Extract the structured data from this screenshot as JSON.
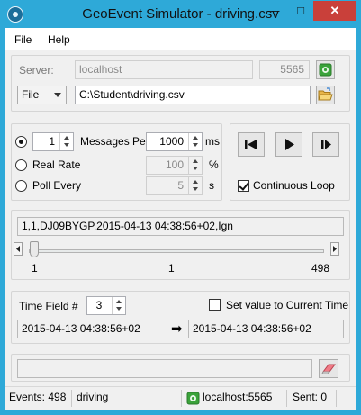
{
  "window": {
    "title": "GeoEvent Simulator - driving.csv",
    "minimize": "—",
    "maximize": "□",
    "close": "✕"
  },
  "menu": {
    "file": "File",
    "help": "Help"
  },
  "connection": {
    "server_label": "Server:",
    "server_value": "localhost",
    "port_value": "5565",
    "source_type": "File",
    "file_path": "C:\\Student\\driving.csv"
  },
  "rate": {
    "messages_count": "1",
    "messages_per_label": "Messages Per",
    "messages_interval": "1000",
    "messages_unit": "ms",
    "real_rate_label": "Real Rate",
    "real_rate_value": "100",
    "real_rate_unit": "%",
    "poll_every_label": "Poll Every",
    "poll_every_value": "5",
    "poll_every_unit": "s",
    "selected": "messages_per"
  },
  "playback": {
    "continuous_loop_label": "Continuous Loop",
    "continuous_loop_checked": true
  },
  "event": {
    "current_line": "1,1,DJ09BYGP,2015-04-13 04:38:56+02,Ign",
    "slider_min": "1",
    "slider_current": "1",
    "slider_max": "498",
    "slider_position": 1
  },
  "time": {
    "field_label": "Time Field #",
    "field_value": "3",
    "set_current_label": "Set value to Current Time",
    "set_current_checked": false,
    "source_time": "2015-04-13 04:38:56+02",
    "target_time": "2015-04-13 04:38:56+02",
    "arrow": "➡"
  },
  "message": {
    "text": ""
  },
  "status": {
    "events": "Events: 498",
    "mode": "driving",
    "host": "localhost:5565",
    "sent": "Sent: 0"
  },
  "colors": {
    "title_bar": "#2ea9d8",
    "close_button": "#c9403a",
    "connected": "#3aa33a"
  }
}
